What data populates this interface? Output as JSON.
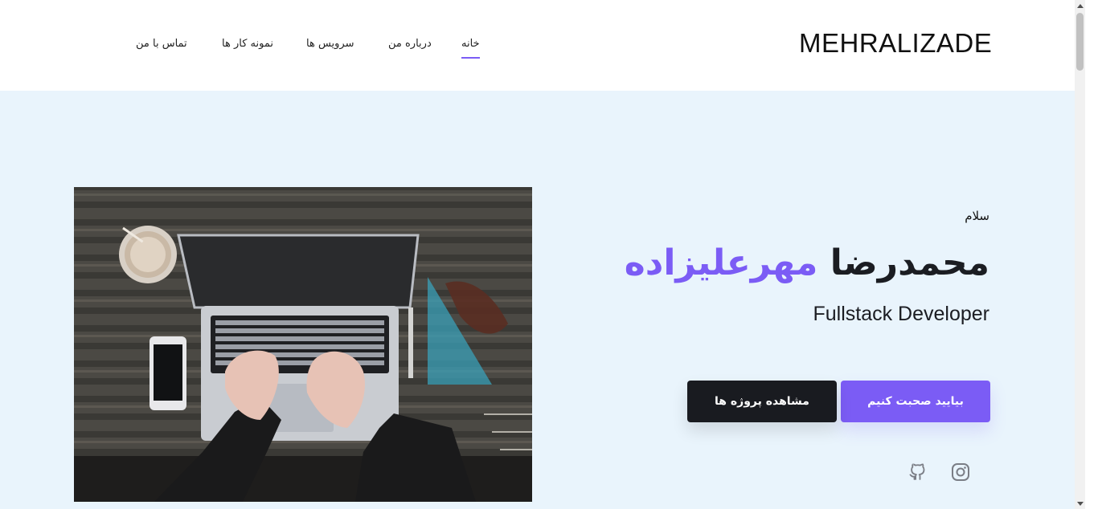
{
  "header": {
    "logo": "MEHRALIZADE",
    "nav": {
      "home": "خانه",
      "about": "درباره من",
      "services": "سرویس ها",
      "portfolio": "نمونه کار ها",
      "contact": "تماس با من"
    },
    "active_item": "home"
  },
  "hero": {
    "greeting": "سلام",
    "first_name": "محمدرضا",
    "last_name": "مهرعلیزاده",
    "role": "Fullstack Developer",
    "primary_button": "بیایید صحبت کنیم",
    "secondary_button": "مشاهده پروژه ها",
    "social_icons": [
      "instagram-icon",
      "github-icon"
    ]
  },
  "colors": {
    "accent": "#7b5cf5",
    "dark": "#191b20",
    "hero_background": "#e9f4fc"
  }
}
